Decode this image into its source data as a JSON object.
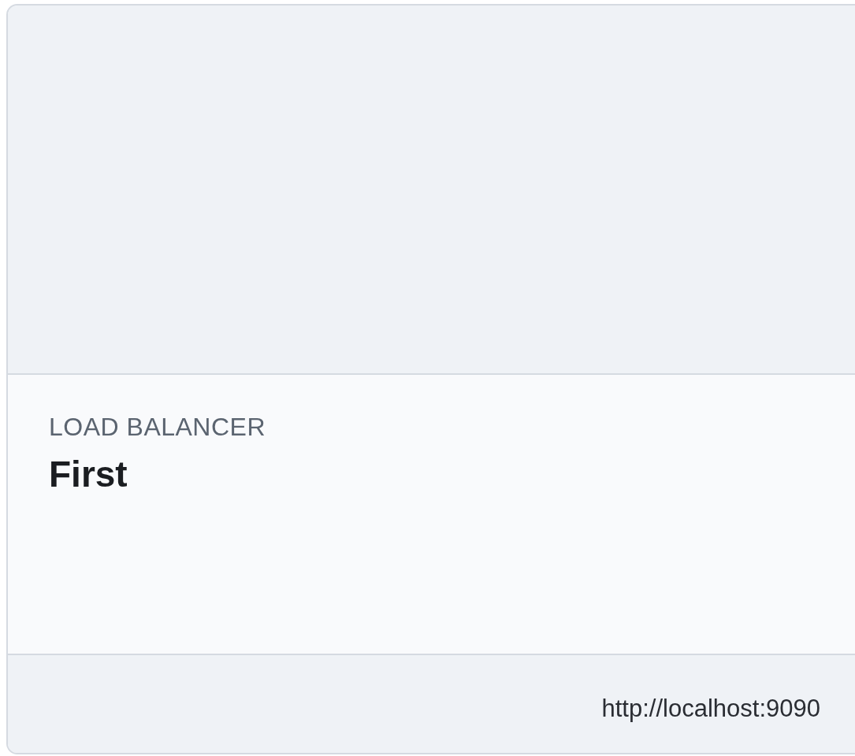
{
  "card": {
    "label": "LOAD BALANCER",
    "title": "First",
    "url": "http://localhost:9090"
  }
}
